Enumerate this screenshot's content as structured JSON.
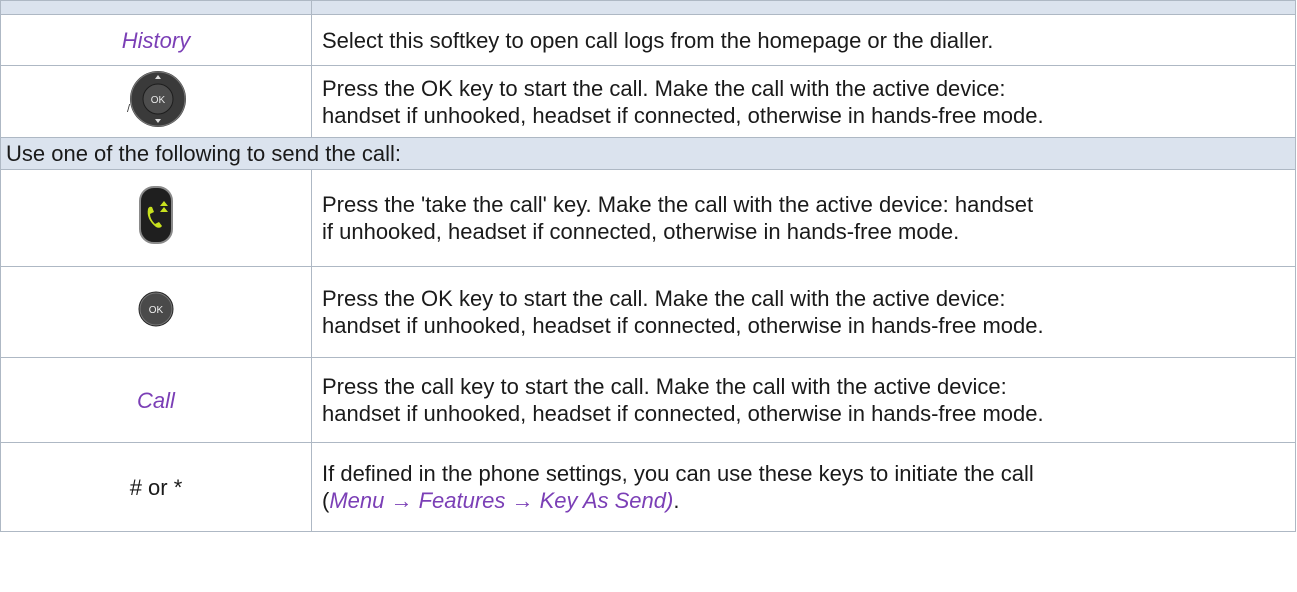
{
  "rows": [
    {
      "key_text": "History",
      "desc": "Select this softkey to open call logs from the homepage or the dialler."
    },
    {
      "key_icon": "nav-ok-key-icon",
      "key_icon_text": "OK",
      "key_icon_prefix": "/",
      "desc_line1": "Press the OK key to start the call. Make the call with the active device:",
      "desc_line2": "handset if unhooked, headset if connected, otherwise in hands-free mode."
    },
    {
      "section": "Use one of the following to send the call:"
    },
    {
      "key_icon": "take-call-key-icon",
      "desc_line1": "Press the 'take the call' key. Make the call with the active device: handset",
      "desc_line2": "if unhooked, headset if connected, otherwise in hands-free mode."
    },
    {
      "key_icon": "ok-button-icon",
      "key_icon_text": "OK",
      "desc_line1": "Press the OK key to start the call. Make the call with the active device:",
      "desc_line2": "handset if unhooked, headset if connected, otherwise in hands-free mode."
    },
    {
      "key_text": "Call",
      "desc_line1": "Press the call key to start the call. Make the call with the active device:",
      "desc_line2": "handset if unhooked, headset if connected, otherwise in hands-free mode."
    },
    {
      "key_text": "# or *",
      "desc_line1": "If defined in the phone settings, you can use these keys to initiate the call",
      "desc_line2_open": "(",
      "desc_line2_menu": "Menu → Features → Key As Send)",
      "desc_line2_close": "."
    }
  ],
  "colors": {
    "softkey_text": "#7b3fb6",
    "row_shade": "#dbe3ee",
    "grid": "#aeb8c4",
    "take_call_green": "#c8e11e"
  }
}
